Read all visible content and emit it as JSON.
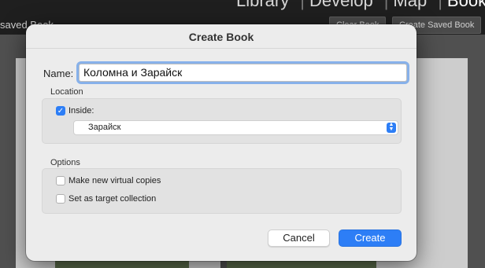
{
  "background": {
    "modules": [
      "Library",
      "Develop",
      "Map",
      "Book"
    ],
    "active_module": "Book",
    "book_title_partial": "saved Book",
    "clear_book_label": "Clear Book",
    "create_saved_book_label": "Create Saved Book"
  },
  "dialog": {
    "title": "Create Book",
    "name_label": "Name:",
    "name_value": "Коломна и Зарайск",
    "location": {
      "section_label": "Location",
      "inside_label": "Inside:",
      "inside_checked": true,
      "collection_value": "Зарайск"
    },
    "options": {
      "section_label": "Options",
      "virtual_copies_label": "Make new virtual copies",
      "virtual_copies_checked": false,
      "target_collection_label": "Set as target collection",
      "target_collection_checked": false
    },
    "cancel_label": "Cancel",
    "create_label": "Create"
  },
  "colors": {
    "accent": "#2d7ef6",
    "dialog_bg": "#ececec",
    "app_bg": "#1f1f1f"
  }
}
